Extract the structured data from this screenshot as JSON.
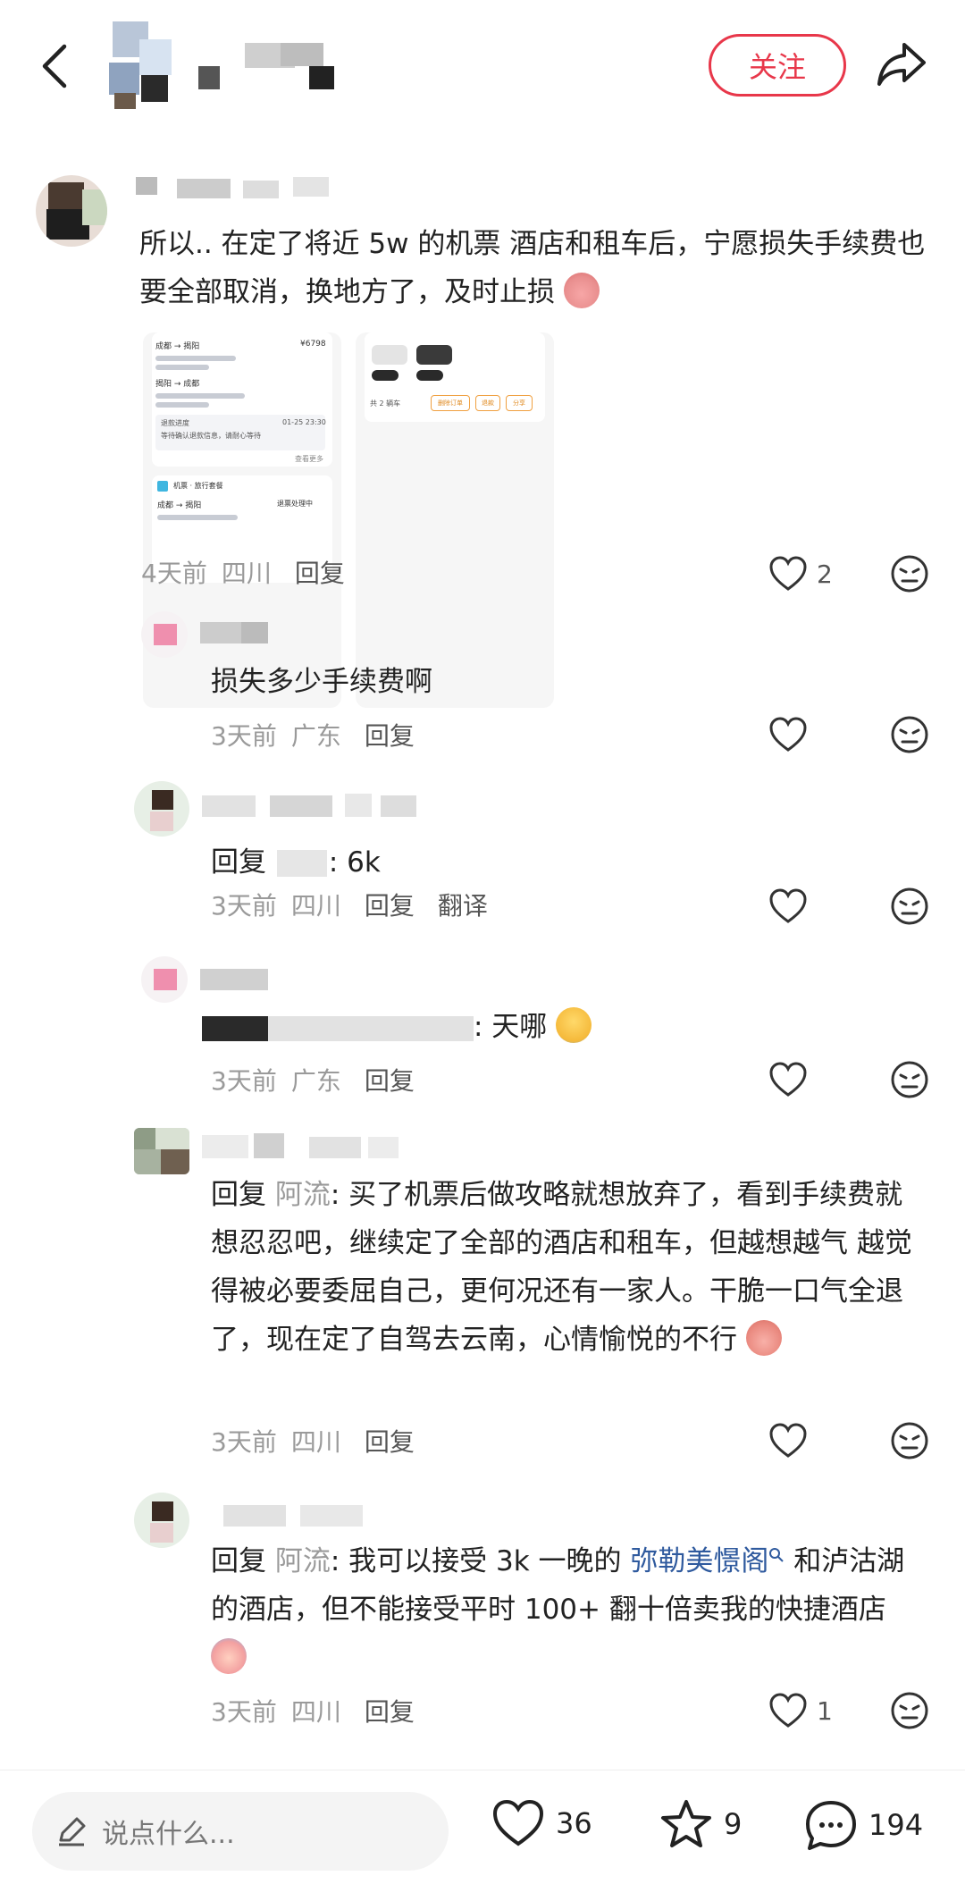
{
  "header": {
    "follow_label": "关注",
    "icons": [
      "back-arrow-icon",
      "share-icon"
    ]
  },
  "comments": [
    {
      "text": "所以.. 在定了将近 5w 的机票 酒店和租车后，宁愿损失手续费也要全部取消，换地方了，及时止损",
      "time": "4天前",
      "location": "四川",
      "reply": "回复",
      "likes": "2",
      "thumb1": {
        "r1a": "成都 → 揭阳",
        "r1b": "¥6798",
        "r2": "揭阳 → 成都",
        "notice1": "退款进度",
        "notice2": "01-25 23:30",
        "notice3": "等待确认退款信息，请耐心等待",
        "more": "查看更多",
        "section": "机票 · 旅行套餐",
        "r3a": "成都 → 揭阳",
        "r3b": "退票处理中"
      },
      "thumb2": {
        "count": "共 2 辆车",
        "b1": "删除订单",
        "b2": "退款",
        "b3": "分享"
      }
    },
    {
      "text": "损失多少手续费啊",
      "time": "3天前",
      "location": "广东",
      "reply": "回复"
    },
    {
      "prefix": "回复",
      "text": ": 6k",
      "time": "3天前",
      "location": "四川",
      "reply": "回复",
      "translate": "翻译"
    },
    {
      "text": ": 天哪",
      "time": "3天前",
      "location": "广东",
      "reply": "回复"
    },
    {
      "prefix": "回复",
      "target": "阿流",
      "text": ": 买了机票后做攻略就想放弃了，看到手续费就想忍忍吧，继续定了全部的酒店和租车，但越想越气 越觉得被必要委屈自己，更何况还有一家人。干脆一口气全退了，现在定了自驾去云南，心情愉悦的不行",
      "time": "3天前",
      "location": "四川",
      "reply": "回复"
    },
    {
      "prefix": "回复",
      "target": "阿流",
      "text_a": ": 我可以接受 3k 一晚的 ",
      "link": "弥勒美憬阁",
      "text_b": " 和泸沽湖的酒店，但不能接受平时 100+ 翻十倍卖我的快捷酒店",
      "time": "3天前",
      "location": "四川",
      "reply": "回复",
      "likes": "1"
    }
  ],
  "bottombar": {
    "placeholder": "说点什么...",
    "likes": "36",
    "stars": "9",
    "comments": "194"
  },
  "colors": {
    "accent": "#e8374a",
    "link": "#2f5a9e",
    "meta": "#9a9a9a"
  }
}
